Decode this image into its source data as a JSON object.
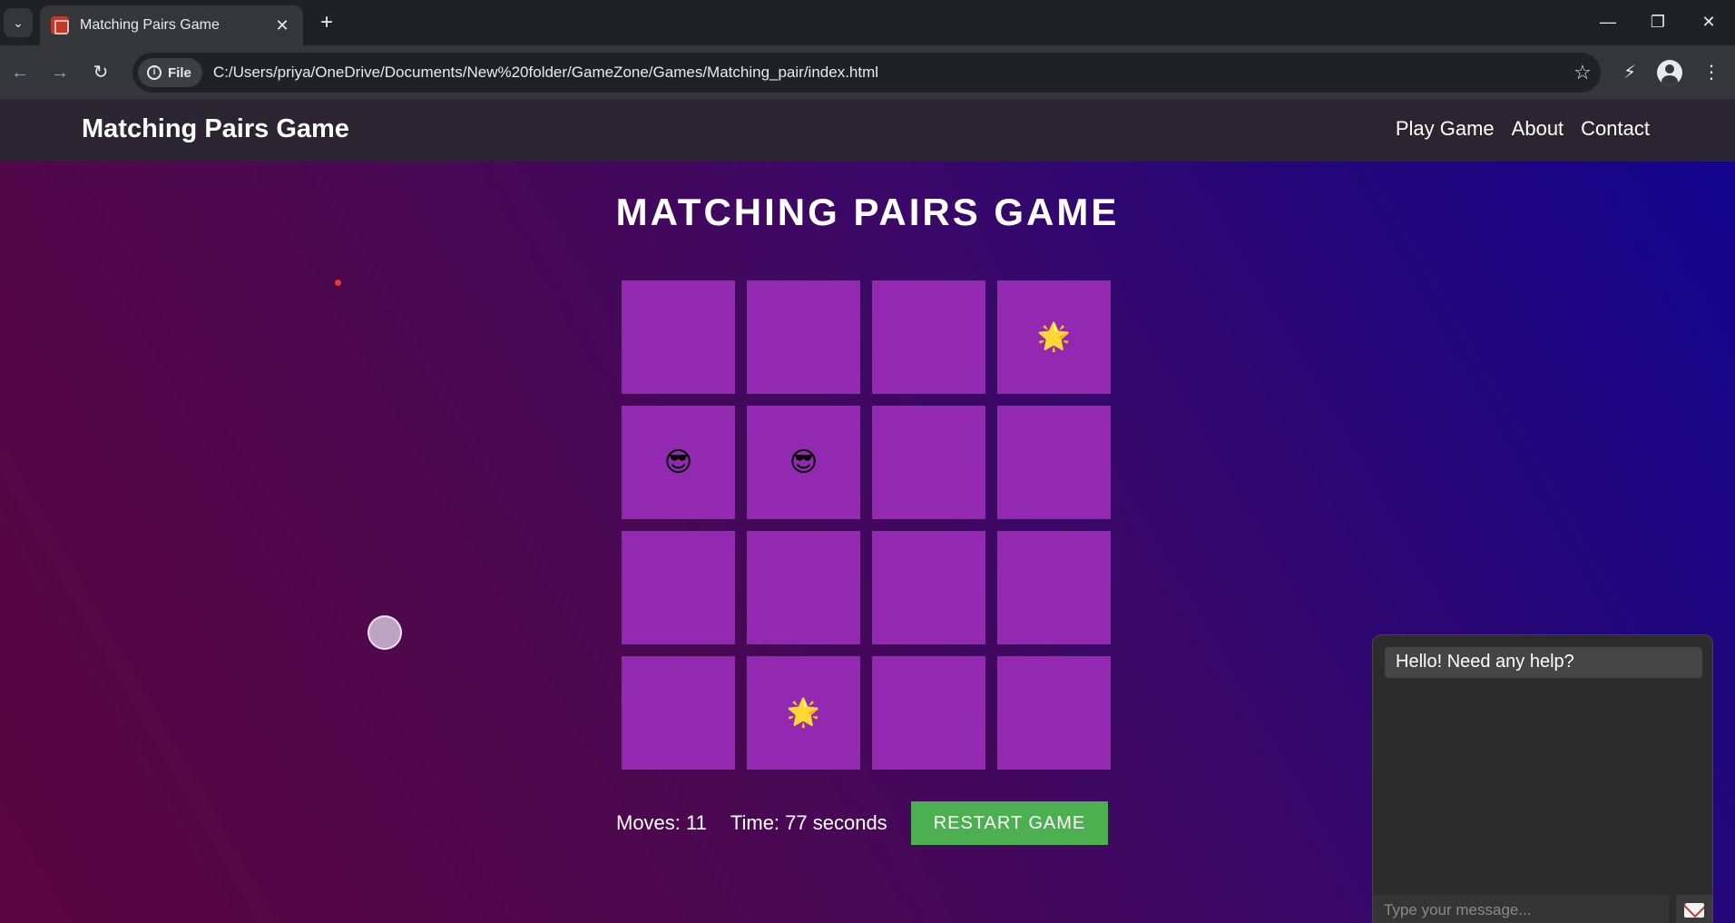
{
  "browser": {
    "tab_title": "Matching Pairs Game",
    "tab_close": "✕",
    "new_tab": "+",
    "tab_list": "⌄",
    "site_chip": "File",
    "url": "C:/Users/priya/OneDrive/Documents/New%20folder/GameZone/Games/Matching_pair/index.html",
    "back": "←",
    "forward": "→",
    "reload": "↻",
    "star": "☆",
    "minimize": "—",
    "restore": "❐",
    "close": "✕",
    "menu": "⋮",
    "extension": "⚡"
  },
  "header": {
    "title": "Matching Pairs Game",
    "nav": [
      "Play Game",
      "About",
      "Contact"
    ]
  },
  "game": {
    "title": "MATCHING PAIRS GAME",
    "cards": [
      "",
      "",
      "",
      "🌟",
      "😎",
      "😎",
      "",
      "",
      "",
      "",
      "",
      "",
      "",
      "🌟",
      "",
      ""
    ],
    "moves": "Moves: 11",
    "time": "Time: 77 seconds",
    "restart_label": "RESTART GAME"
  },
  "chat": {
    "greeting": "Hello! Need any help?",
    "placeholder": "Type your message..."
  },
  "colors": {
    "card": "#9229b0",
    "restart": "#4caf50",
    "header": "#2a2530"
  }
}
